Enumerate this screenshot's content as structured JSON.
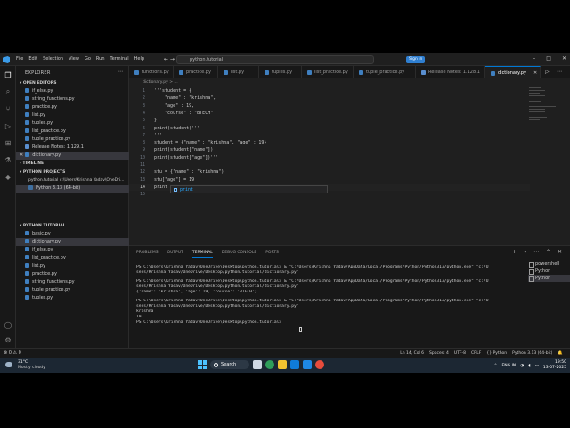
{
  "titlebar": {
    "menu": [
      "File",
      "Edit",
      "Selection",
      "View",
      "Go",
      "Run",
      "Terminal",
      "Help"
    ],
    "search": "python.tutorial",
    "sign_in": "Sign in",
    "nav": "← →"
  },
  "sidebar": {
    "title": "EXPLORER",
    "open_editors_label": "OPEN EDITORS",
    "open_editors": [
      "if_else.py",
      "string_functions.py",
      "practice.py",
      "list.py",
      "tuples.py",
      "list_practice.py",
      "tuple_practice.py",
      "Release Notes: 1.129.1",
      "dictionary.py"
    ],
    "timeline_label": "TIMELINE",
    "python_projects_label": "PYTHON PROJECTS",
    "project_path": "python.tutorial  c:\\Users\\Krishna Yadav\\OneDri...",
    "interpreter": "Python 3.13 (64-bit)",
    "folder_label": "PYTHON.TUTORIAL",
    "files": [
      "basic.py",
      "dictionary.py",
      "if_else.py",
      "list_practice.py",
      "list.py",
      "practice.py",
      "string_functions.py",
      "tuple_practice.py",
      "tuples.py"
    ]
  },
  "tabs": [
    "functions.py",
    "practice.py",
    "list.py",
    "tuples.py",
    "list_practice.py",
    "tuple_practice.py",
    "Release Notes: 1.128.1",
    "dictionary.py"
  ],
  "breadcrumb": "dictionary.py > ...",
  "code": [
    {
      "n": "1",
      "t": "'''student = {"
    },
    {
      "n": "2",
      "t": "    \"name\" : \"krishna\","
    },
    {
      "n": "3",
      "t": "    \"age\" : 19,"
    },
    {
      "n": "4",
      "t": "    \"course\" : \"BTECH\""
    },
    {
      "n": "5",
      "t": "}"
    },
    {
      "n": "6",
      "t": "print(student)'''"
    },
    {
      "n": "7",
      "t": "'''"
    },
    {
      "n": "8",
      "t": "student = {\"name\" : \"krishna\", \"age\" : 19}"
    },
    {
      "n": "9",
      "t": "print(student[\"name\"])"
    },
    {
      "n": "10",
      "t": "print(student[\"age\"])'''"
    },
    {
      "n": "11",
      "t": ""
    },
    {
      "n": "12",
      "t": "stu = {\"name\" : \"krishna\")"
    },
    {
      "n": "13",
      "t": "stu[\"age\"] = 19"
    },
    {
      "n": "14",
      "t": "print"
    },
    {
      "n": "15",
      "t": ""
    }
  ],
  "suggestion": "print",
  "panel": {
    "tabs": [
      "PROBLEMS",
      "OUTPUT",
      "TERMINAL",
      "DEBUG CONSOLE",
      "PORTS"
    ],
    "active_tab": "TERMINAL",
    "buttons": "+ ▾ ⋯ ⌃ ✕",
    "terminal_lines": [
      "PS C:\\Users\\Krishna Yadav\\OneDrive\\Desktop\\python.tutorial> & \"C:/Users/Krishna Yadav/AppData/Local/Programs/Python/Python313/python.exe\" \"c:/U",
      "sers/Krishna Yadav/OneDrive/Desktop/python.tutorial/dictionary.py\"",
      "PS C:\\Users\\Krishna Yadav\\OneDrive\\Desktop\\python.tutorial> & \"C:/Users/Krishna Yadav/AppData/Local/Programs/Python/Python313/python.exe\" \"c:/U",
      "sers/Krishna Yadav/OneDrive/Desktop/python.tutorial/dictionary.py\"",
      "{'name': 'krishna', 'age': 19, 'course': 'BTECH'}",
      "PS C:\\Users\\Krishna Yadav\\OneDrive\\Desktop\\python.tutorial> & \"C:/Users/Krishna Yadav/AppData/Local/Programs/Python/Python313/python.exe\" \"c:/U",
      "sers/Krishna Yadav/OneDrive/Desktop/python.tutorial/dictionary.py\"",
      "krishna",
      "19",
      "PS C:\\Users\\Krishna Yadav\\OneDrive\\Desktop\\python.tutorial> "
    ],
    "terminal_list": [
      "powershell",
      "Python",
      "Python"
    ]
  },
  "statusbar": {
    "left": "⊗ 0 ⚠ 0",
    "items": [
      "Ln 14, Col 6",
      "Spaces: 4",
      "UTF-8",
      "CRLF",
      "{} Python",
      "Python 3.13 (64-bit)"
    ]
  },
  "taskbar": {
    "weather_temp": "31°C",
    "weather_desc": "Mostly cloudy",
    "search": "Search",
    "tray_lang": "ENG IN",
    "time": "19:50",
    "date": "13-07-2025"
  }
}
